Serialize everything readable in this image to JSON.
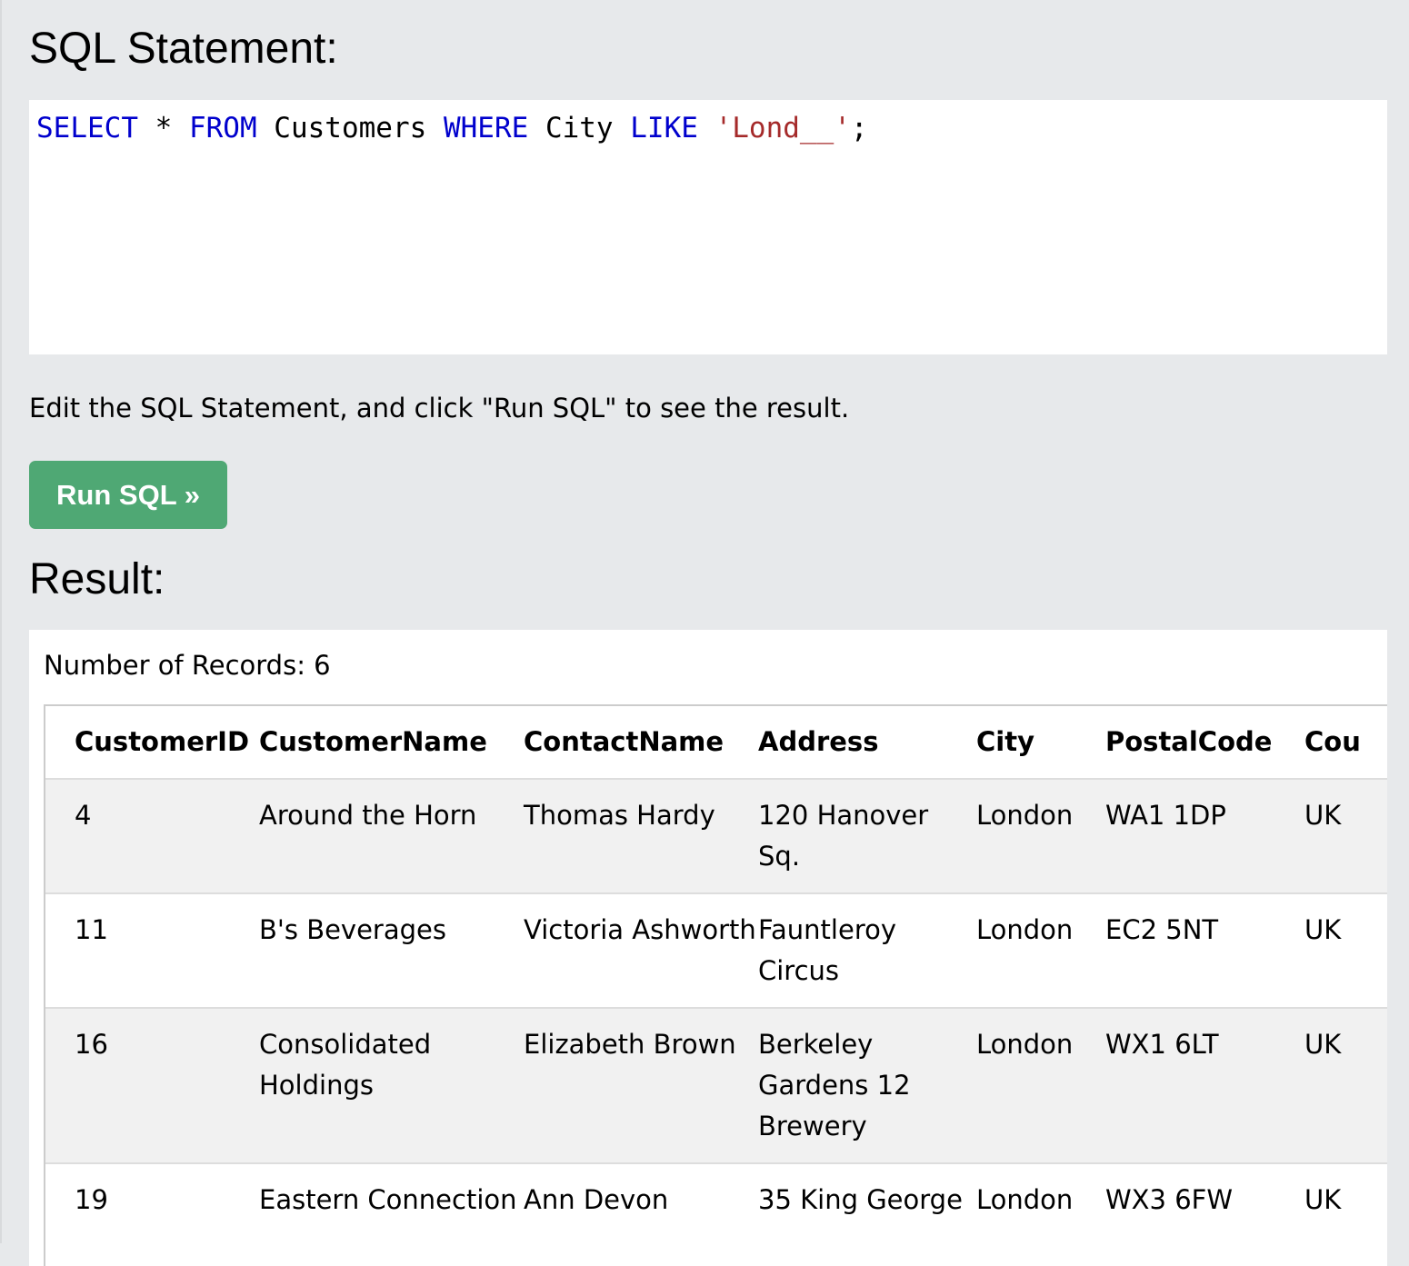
{
  "sql_section": {
    "title": "SQL Statement:",
    "query_tokens": [
      {
        "text": "SELECT",
        "type": "keyword"
      },
      {
        "text": " * ",
        "type": "plain"
      },
      {
        "text": "FROM",
        "type": "keyword"
      },
      {
        "text": " Customers ",
        "type": "plain"
      },
      {
        "text": "WHERE",
        "type": "keyword"
      },
      {
        "text": " City ",
        "type": "plain"
      },
      {
        "text": "LIKE",
        "type": "keyword"
      },
      {
        "text": " ",
        "type": "plain"
      },
      {
        "text": "'Lond__'",
        "type": "string"
      },
      {
        "text": ";",
        "type": "plain"
      }
    ],
    "hint": "Edit the SQL Statement, and click \"Run SQL\" to see the result.",
    "run_button_label": "Run SQL »"
  },
  "result_section": {
    "title": "Result:",
    "record_count_text": "Number of Records: 6",
    "columns": [
      "CustomerID",
      "CustomerName",
      "ContactName",
      "Address",
      "City",
      "PostalCode",
      "Cou"
    ],
    "rows": [
      [
        "4",
        "Around the Horn",
        "Thomas Hardy",
        "120 Hanover Sq.",
        "London",
        "WA1 1DP",
        "UK"
      ],
      [
        "11",
        "B's Beverages",
        "Victoria Ashworth",
        "Fauntleroy Circus",
        "London",
        "EC2 5NT",
        "UK"
      ],
      [
        "16",
        "Consolidated Holdings",
        "Elizabeth Brown",
        "Berkeley Gardens 12 Brewery",
        "London",
        "WX1 6LT",
        "UK"
      ],
      [
        "19",
        "Eastern Connection",
        "Ann Devon",
        "35 King George",
        "London",
        "WX3 6FW",
        "UK"
      ]
    ]
  },
  "colors": {
    "page_background": "#e7e9eb",
    "keyword": "#0000cd",
    "string": "#a52a2a",
    "run_button": "#4fa874",
    "row_odd": "#f1f1f1"
  }
}
